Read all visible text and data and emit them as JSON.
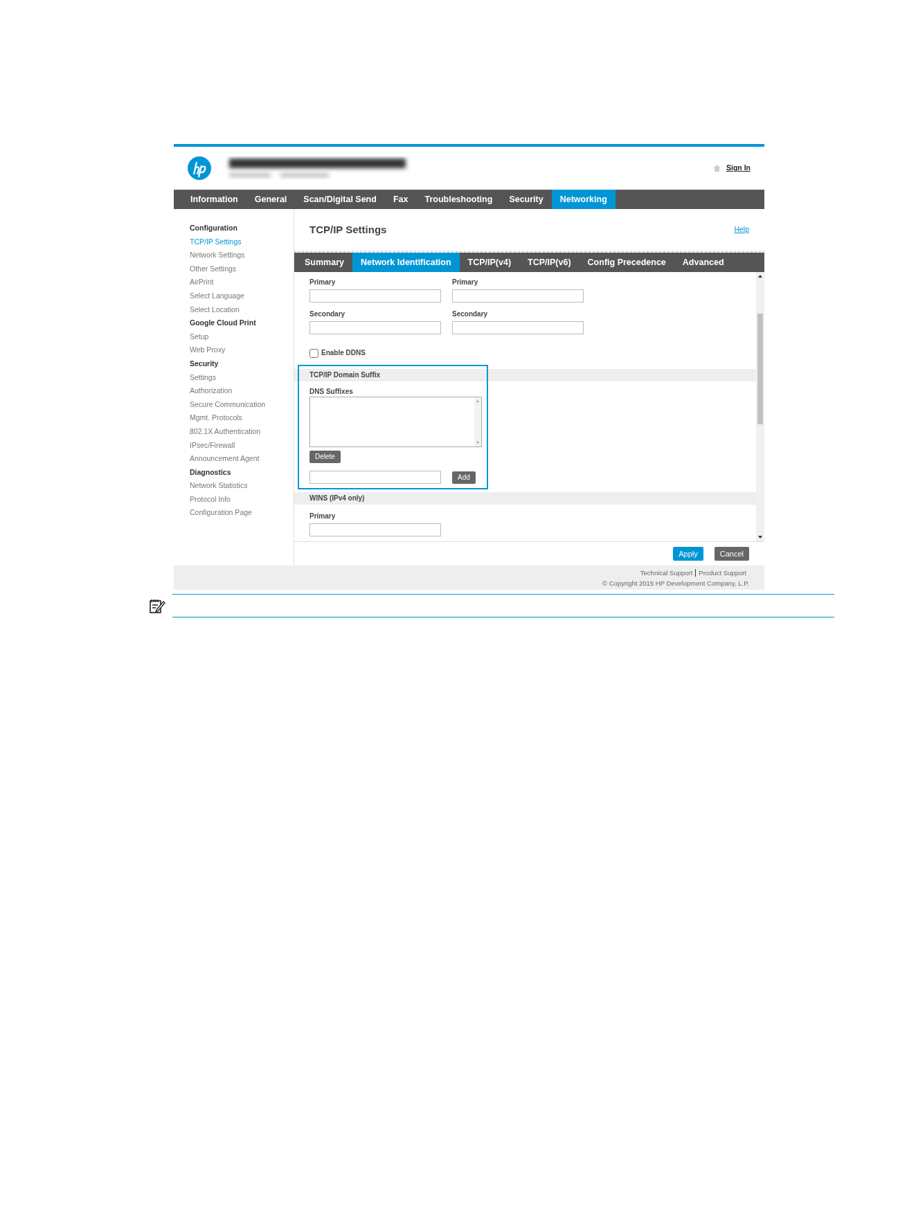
{
  "header": {
    "sign_in": "Sign In"
  },
  "nav_tabs": [
    {
      "label": "Information",
      "selected": false
    },
    {
      "label": "General",
      "selected": false
    },
    {
      "label": "Scan/Digital Send",
      "selected": false
    },
    {
      "label": "Fax",
      "selected": false
    },
    {
      "label": "Troubleshooting",
      "selected": false
    },
    {
      "label": "Security",
      "selected": false
    },
    {
      "label": "Networking",
      "selected": true
    }
  ],
  "sidebar": [
    {
      "title": "Configuration",
      "items": [
        {
          "label": "TCP/IP Settings",
          "selected": true
        },
        {
          "label": "Network Settings",
          "selected": false
        },
        {
          "label": "Other Settings",
          "selected": false
        },
        {
          "label": "AirPrint",
          "selected": false
        },
        {
          "label": "Select Language",
          "selected": false
        },
        {
          "label": "Select Location",
          "selected": false
        }
      ]
    },
    {
      "title": "Google Cloud Print",
      "items": [
        {
          "label": "Setup",
          "selected": false
        },
        {
          "label": "Web Proxy",
          "selected": false
        }
      ]
    },
    {
      "title": "Security",
      "items": [
        {
          "label": "Settings",
          "selected": false
        },
        {
          "label": "Authorization",
          "selected": false
        },
        {
          "label": "Secure Communication",
          "selected": false
        },
        {
          "label": "Mgmt. Protocols",
          "selected": false
        },
        {
          "label": "802.1X Authentication",
          "selected": false
        },
        {
          "label": "IPsec/Firewall",
          "selected": false
        },
        {
          "label": "Announcement Agent",
          "selected": false
        }
      ]
    },
    {
      "title": "Diagnostics",
      "items": [
        {
          "label": "Network Statistics",
          "selected": false
        },
        {
          "label": "Protocol Info",
          "selected": false
        },
        {
          "label": "Configuration Page",
          "selected": false
        }
      ]
    }
  ],
  "page_title": "TCP/IP Settings",
  "help": "Help",
  "sub_tabs": [
    {
      "label": "Summary",
      "selected": false
    },
    {
      "label": "Network Identification",
      "selected": true
    },
    {
      "label": "TCP/IP(v4)",
      "selected": false
    },
    {
      "label": "TCP/IP(v6)",
      "selected": false
    },
    {
      "label": "Config Precedence",
      "selected": false
    },
    {
      "label": "Advanced",
      "selected": false
    }
  ],
  "dns_fields": [
    {
      "left": "Primary",
      "right": "Primary"
    },
    {
      "left": "Secondary",
      "right": "Secondary"
    }
  ],
  "ddns": {
    "label": "Enable DDNS",
    "checked": false
  },
  "domain_suffix": {
    "title": "TCP/IP Domain Suffix",
    "highlighted": true,
    "list_label": "DNS Suffixes",
    "delete": "Delete",
    "add": "Add"
  },
  "wins": {
    "title": "WINS (IPv4 only)",
    "field_label": "Primary"
  },
  "actions": {
    "apply": "Apply",
    "cancel": "Cancel"
  },
  "footer": {
    "links": [
      "Technical Support",
      "Product Support"
    ],
    "copyright": "© Copyright 2015 HP Development Company, L.P."
  }
}
